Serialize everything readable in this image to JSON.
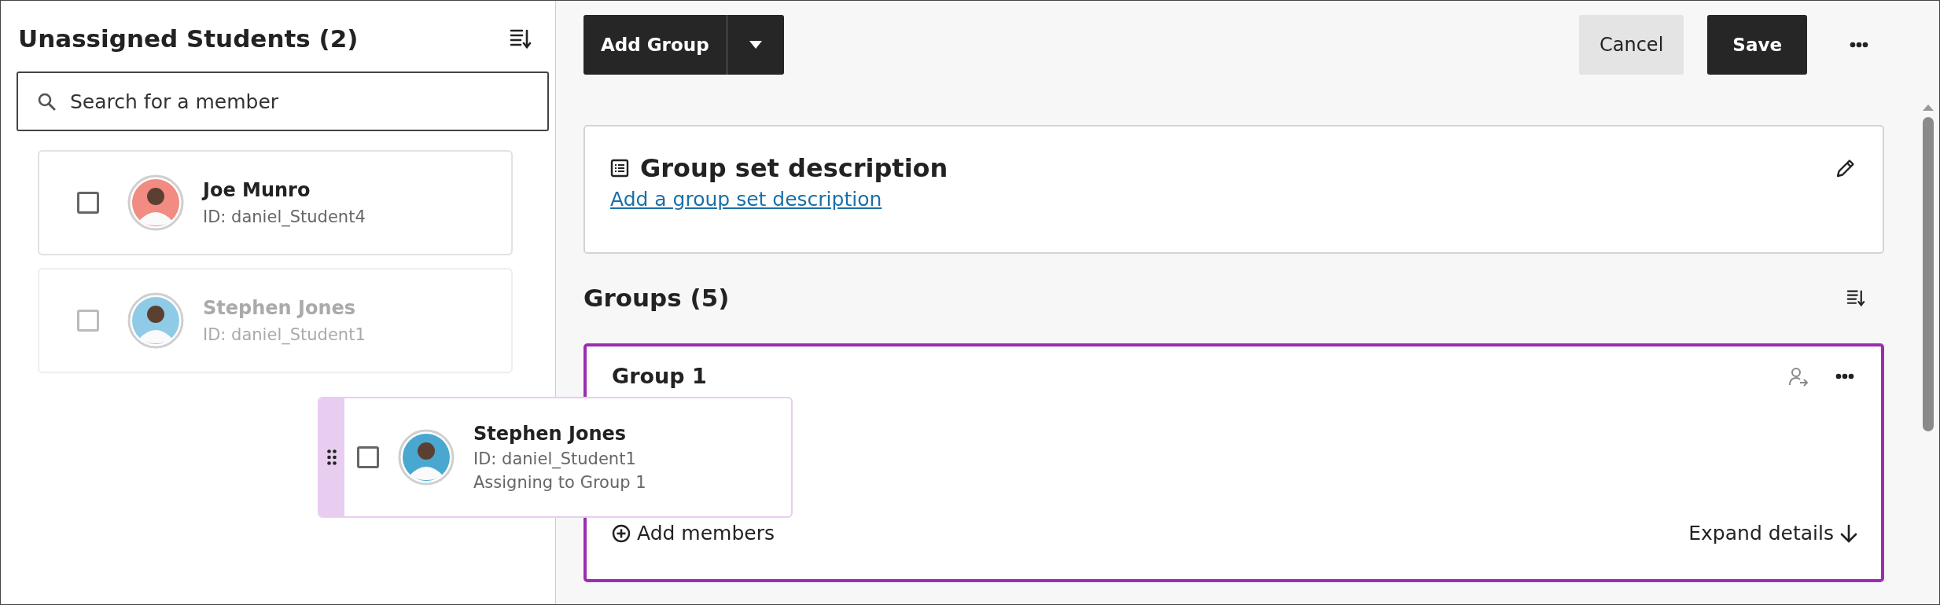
{
  "left_panel": {
    "title": "Unassigned Students (2)",
    "search": {
      "placeholder": "Search for a member"
    },
    "students": [
      {
        "name": "Joe Munro",
        "id": "ID: daniel_Student4",
        "checked": false,
        "dragging": false,
        "color": "#f28b82"
      },
      {
        "name": "Stephen Jones",
        "id": "ID: daniel_Student1",
        "checked": false,
        "dragging": true,
        "color": "#8fcbe6"
      }
    ]
  },
  "toolbar": {
    "add_group": "Add Group",
    "cancel": "Cancel",
    "save": "Save"
  },
  "description": {
    "title": "Group set description",
    "link": "Add a group set description"
  },
  "groups": {
    "title": "Groups (5)",
    "items": [
      {
        "name": "Group 1",
        "selected": true,
        "add_members": "Add members",
        "expand": "Expand details"
      }
    ]
  },
  "drag_card": {
    "name": "Stephen Jones",
    "id": "ID: daniel_Student1",
    "status": "Assigning to Group 1",
    "checked": false,
    "color": "#4aa8d0"
  }
}
